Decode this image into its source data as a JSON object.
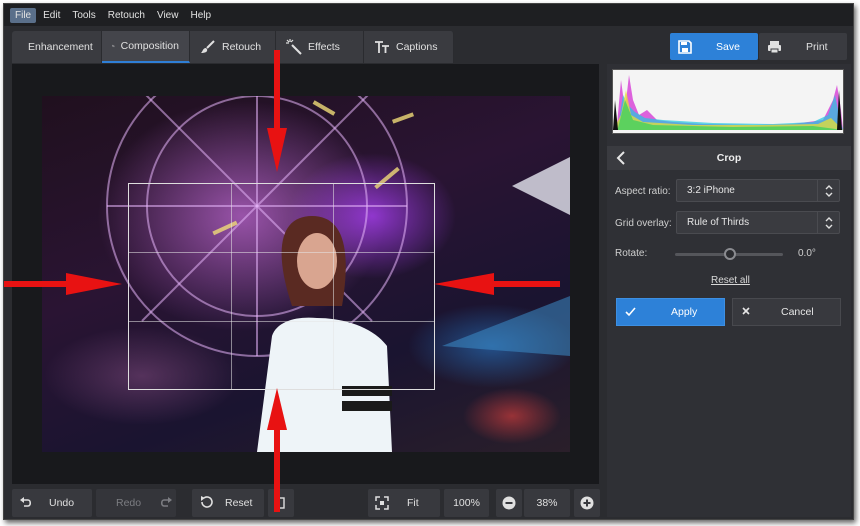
{
  "menu": [
    "File",
    "Edit",
    "Tools",
    "Retouch",
    "View",
    "Help"
  ],
  "tabs": [
    {
      "label": "Enhancement",
      "icon": "sliders-icon"
    },
    {
      "label": "Composition",
      "icon": "crop-icon"
    },
    {
      "label": "Retouch",
      "icon": "brush-icon"
    },
    {
      "label": "Effects",
      "icon": "magic-wand-icon"
    },
    {
      "label": "Captions",
      "icon": "text-icon"
    }
  ],
  "actions": {
    "save": "Save",
    "print": "Print"
  },
  "bottom": {
    "undo": "Undo",
    "redo": "Redo",
    "reset": "Reset",
    "fit": "Fit",
    "zoom100": "100%",
    "zoom_value": "38%"
  },
  "panel": {
    "title": "Crop",
    "aspect_label": "Aspect ratio:",
    "aspect_value": "3:2 iPhone",
    "grid_label": "Grid overlay:",
    "grid_value": "Rule of Thirds",
    "rotate_label": "Rotate:",
    "rotate_value": "0.0°",
    "reset_all": "Reset all",
    "apply": "Apply",
    "cancel": "Cancel"
  },
  "colors": {
    "accent": "#2d81d8",
    "arrow": "#e81212"
  }
}
